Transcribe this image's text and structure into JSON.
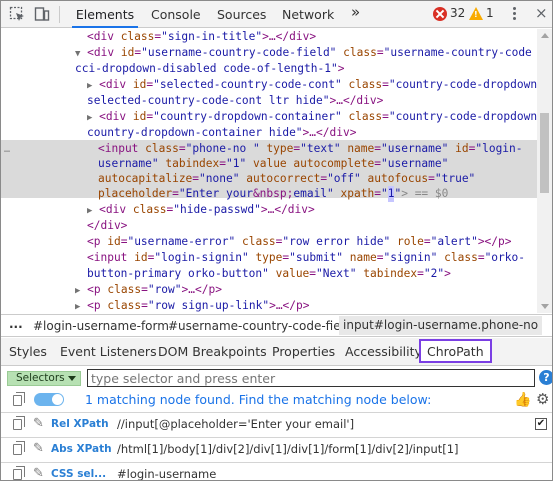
{
  "toolbar": {
    "tabs": [
      "Elements",
      "Console",
      "Sources",
      "Network"
    ],
    "more_tabs": "»",
    "error_count": "32",
    "warning_count": "1",
    "close": "×"
  },
  "code": {
    "ln1": {
      "open": "<div ",
      "attr1": "class",
      "val1": "\"sign-in-title\"",
      "rest": ">…</div>"
    },
    "ln2": {
      "tri": "▼",
      "open": "<div ",
      "a1": "id",
      "v1": "\"username-country-code-field\"",
      "a2": "class",
      "v2": "\"username-country-code"
    },
    "ln3": {
      "v": "cci-dropdown-disabled code-of-length-1\"",
      "close": ">"
    },
    "ln4": {
      "tri": "▶",
      "open": "<div ",
      "a1": "id",
      "v1": "\"selected-country-code-cont\"",
      "a2": "class",
      "v2": "\"country-code-dropdown"
    },
    "ln5": {
      "v": "selected-country-code-cont ltr hide\"",
      "close": ">…</div>"
    },
    "ln6": {
      "tri": "▶",
      "open": "<div ",
      "a1": "id",
      "v1": "\"country-dropdown-container\"",
      "a2": "class",
      "v2": "\"country-code-dropdown"
    },
    "ln7": {
      "v": "country-dropdown-container hide\"",
      "close": ">…</div>"
    },
    "ln8": {
      "open": "<input ",
      "a1": "class",
      "v1": "\"phone-no \"",
      "a2": "type",
      "v2": "\"text\"",
      "a3": "name",
      "v3": "\"username\"",
      "a4": "id",
      "v4": "\"login-"
    },
    "ln9": {
      "v": "username\"",
      "a1": "tabindex",
      "v1": "\"1\"",
      "a2": "value",
      "a3": "autocomplete",
      "v3": "\"username\""
    },
    "ln10": {
      "a1": "autocapitalize",
      "v1": "\"none\"",
      "a2": "autocorrect",
      "v2": "\"off\"",
      "a3": "autofocus",
      "v3": "\"true\""
    },
    "ln11": {
      "a1": "placeholder",
      "v1a": "\"Enter your",
      "nbsp": "&nbsp;",
      "v1b": "email\"",
      "a2": "xpath",
      "v2a": "\"",
      "v2b": "1",
      "v2c": "\"",
      "tail": "> == $0"
    },
    "ln12": {
      "tri": "▶",
      "open": "<div ",
      "a1": "class",
      "v1": "\"hide-passwd\"",
      "close": ">…</div>"
    },
    "ln13": {
      "t": "</div>"
    },
    "ln14": {
      "open": "<p ",
      "a1": "id",
      "v1": "\"username-error\"",
      "a2": "class",
      "v2": "\"row error hide\"",
      "a3": "role",
      "v3": "\"alert\"",
      "close": "></p>"
    },
    "ln15": {
      "open": "<input ",
      "a1": "id",
      "v1": "\"login-signin\"",
      "a2": "type",
      "v2": "\"submit\"",
      "a3": "name",
      "v3": "\"signin\"",
      "a4": "class",
      "v4": "\"orko-"
    },
    "ln16": {
      "v": "button-primary orko-button\"",
      "a1": "value",
      "v1": "\"Next\"",
      "a2": "tabindex",
      "v2": "\"2\"",
      "close": ">"
    },
    "ln17": {
      "tri": "▶",
      "open": "<p ",
      "a1": "class",
      "v1": "\"row\"",
      "close": ">…</p>"
    },
    "ln18": {
      "tri": "▶",
      "open": "<p ",
      "a1": "class",
      "v1": "\"row sign-up-link\"",
      "close": ">…</p>"
    },
    "ellipsis": "…"
  },
  "breadcrumb": {
    "dots": "...",
    "items": [
      "#login-username-form",
      "#username-country-code-field",
      "input#login-username.phone-no"
    ]
  },
  "panel_tabs": [
    "Styles",
    "Event Listeners",
    "DOM Breakpoints",
    "Properties",
    "Accessibility",
    "ChroPath"
  ],
  "chropath": {
    "selector_dropdown": "Selectors",
    "input_placeholder": "type selector and press enter",
    "help": "?",
    "status": "1 matching node found. Find the matching node below:",
    "rows": [
      {
        "label": "Rel XPath",
        "value": "//input[@placeholder='Enter your email']"
      },
      {
        "label": "Abs XPath",
        "value": "/html[1]/body[1]/div[2]/div[1]/div[1]/form[1]/div[2]/input[1]"
      },
      {
        "label": "CSS sel...",
        "value": "#login-username"
      }
    ],
    "checkbox_mark": "✔"
  },
  "icons": [
    "inspect-icon",
    "device-toolbar-icon",
    "error-icon",
    "warning-icon",
    "more-icon",
    "toggle-icon",
    "copy-icon",
    "edit-icon",
    "thumbs-up-icon",
    "settings-icon"
  ]
}
